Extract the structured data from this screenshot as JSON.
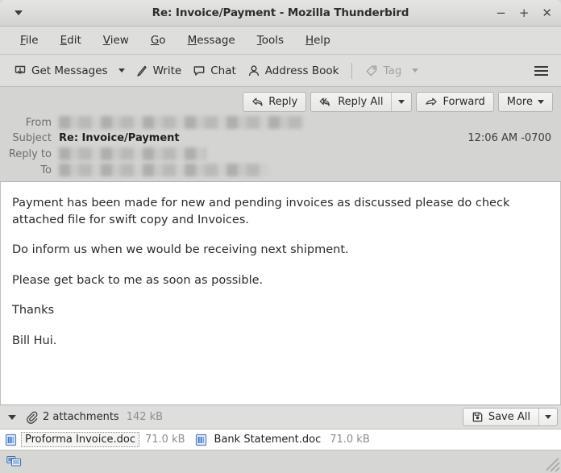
{
  "window": {
    "title": "Re: Invoice/Payment - Mozilla Thunderbird",
    "app_menu_icon": "chevron-down-icon",
    "controls": {
      "minimize": "−",
      "maximize": "+",
      "close": "✕"
    }
  },
  "menubar": {
    "items": [
      {
        "label": "File",
        "accel": "F"
      },
      {
        "label": "Edit",
        "accel": "E"
      },
      {
        "label": "View",
        "accel": "V"
      },
      {
        "label": "Go",
        "accel": "G"
      },
      {
        "label": "Message",
        "accel": "M"
      },
      {
        "label": "Tools",
        "accel": "T"
      },
      {
        "label": "Help",
        "accel": "H"
      }
    ]
  },
  "toolbar": {
    "get_messages": "Get Messages",
    "write": "Write",
    "chat": "Chat",
    "address_book": "Address Book",
    "tag": "Tag",
    "tag_disabled": true,
    "app_menu_icon": "hamburger-icon"
  },
  "message_actions": {
    "reply": "Reply",
    "reply_all": "Reply All",
    "forward": "Forward",
    "more": "More"
  },
  "message_header": {
    "labels": {
      "from": "From",
      "subject": "Subject",
      "reply_to": "Reply to",
      "to": "To"
    },
    "from_value": "",
    "subject_value": "Re: Invoice/Payment",
    "reply_to_value": "",
    "to_value": "",
    "timestamp": "12:06 AM -0700"
  },
  "message_body": {
    "paragraphs": [
      "Payment has been made for new and pending invoices as discussed please do check attached file for swift copy and Invoices.",
      "Do inform us when we would be receiving next shipment.",
      "Please get back to me as soon as possible.",
      "Thanks",
      "Bill Hui."
    ]
  },
  "attachments": {
    "summary_label": "2 attachments",
    "total_size": "142 kB",
    "save_all_label": "Save All",
    "items": [
      {
        "name": "Proforma Invoice.doc",
        "size": "71.0 kB",
        "selected": true
      },
      {
        "name": "Bank Statement.doc",
        "size": "71.0 kB",
        "selected": false
      }
    ]
  },
  "statusbar": {
    "connection_icon": "network-monitors-icon"
  },
  "colors": {
    "chrome": "#dededc",
    "titlebar": "#e0e0de",
    "header": "#d4d4d2",
    "body": "#ffffff",
    "text": "#2b2b2b",
    "muted": "#8e8e8c",
    "border": "#b4b4b2",
    "attachment_icon": "#3f7fcf"
  }
}
